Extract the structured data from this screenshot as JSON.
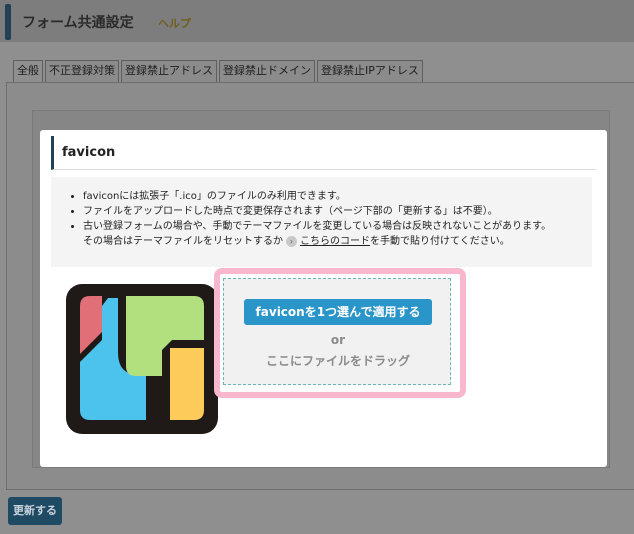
{
  "header": {
    "title": "フォーム共通設定",
    "help_label": "ヘルプ"
  },
  "tabs": [
    {
      "label": "全般",
      "active": true
    },
    {
      "label": "不正登録対策",
      "active": false
    },
    {
      "label": "登録禁止アドレス",
      "active": false
    },
    {
      "label": "登録禁止ドメイン",
      "active": false
    },
    {
      "label": "登録禁止IPアドレス",
      "active": false
    }
  ],
  "footer": {
    "update_label": "更新する"
  },
  "modal": {
    "title": "favicon",
    "notes": [
      "faviconには拡張子「.ico」のファイルのみ利用できます。",
      "ファイルをアップロードした時点で変更保存されます（ページ下部の「更新する」は不要）。",
      "古い登録フォームの場合や、手動でテーマファイルを変更している場合は反映されないことがあります。"
    ],
    "note_continuation_before": "その場合はテーマファイルをリセットするか",
    "code_link": "こちらのコード",
    "note_continuation_after": "を手動で貼り付けてください。",
    "upload": {
      "button_label": "faviconを1つ選んで適用する",
      "or_label": "or",
      "drag_label": "ここにファイルをドラッグ"
    }
  },
  "colors": {
    "accent_navy": "#234156",
    "button_blue": "#2a95c9",
    "highlight_pink": "#f8b7cc",
    "logo_red": "#e06f78",
    "logo_blue": "#4cc3ec",
    "logo_green": "#b2e07f",
    "logo_yellow": "#fccb5a"
  }
}
